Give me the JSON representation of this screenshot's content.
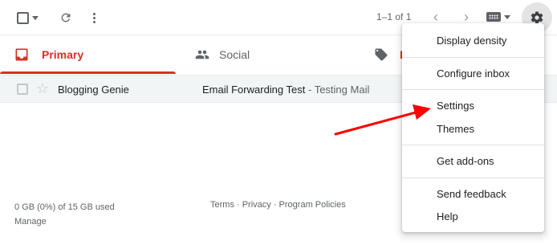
{
  "toolbar": {
    "pager_text": "1–1 of 1",
    "icons": [
      "select-checkbox",
      "refresh-icon",
      "more-vert-icon",
      "chevron-left-icon",
      "chevron-right-icon",
      "keyboard-icon",
      "settings-gear-icon"
    ]
  },
  "tabs": [
    {
      "label": "Primary",
      "icon": "inbox-icon",
      "active": true,
      "color": "#d93025"
    },
    {
      "label": "Social",
      "icon": "people-icon",
      "active": false
    },
    {
      "label": "P",
      "icon": "tag-icon",
      "active": false,
      "color": "#d93025"
    }
  ],
  "email": {
    "sender": "Blogging Genie",
    "subject": "Email Forwarding Test",
    "separator": " - ",
    "snippet": "Testing Mail"
  },
  "footer": {
    "storage": "0 GB (0%) of 15 GB used",
    "manage": "Manage",
    "links": "Terms · Privacy · Program Policies"
  },
  "menu": {
    "items": [
      {
        "label": "Display density"
      },
      {
        "label": "Configure inbox"
      },
      {
        "label": "Settings"
      },
      {
        "label": "Themes"
      },
      {
        "label": "Get add-ons"
      },
      {
        "label": "Send feedback"
      },
      {
        "label": "Help"
      }
    ]
  },
  "annotation": {
    "type": "arrow",
    "color": "#ff0000",
    "points_to": "Settings"
  }
}
